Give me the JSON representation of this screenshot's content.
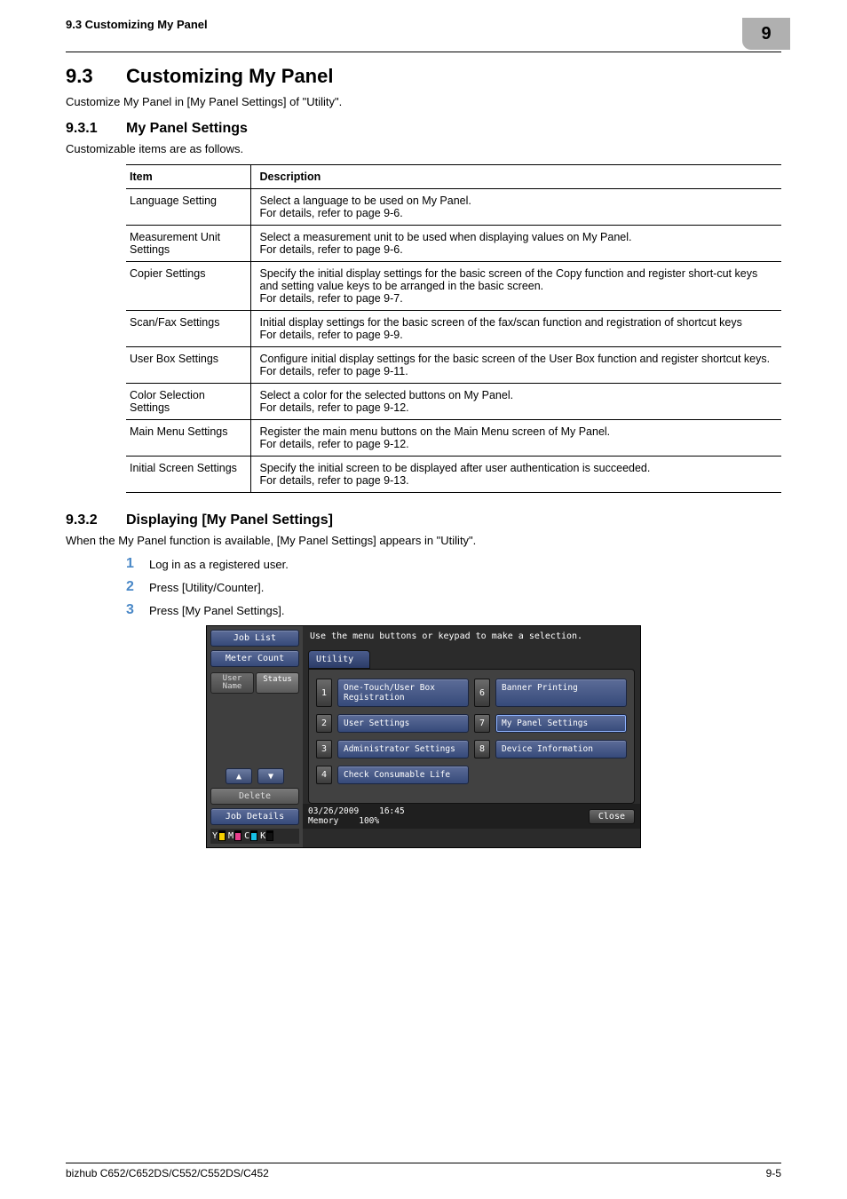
{
  "running_header": {
    "left": "9.3    Customizing My Panel",
    "chapter": "9"
  },
  "h2": {
    "num": "9.3",
    "title": "Customizing My Panel"
  },
  "h2_body": "Customize My Panel in [My Panel Settings] of \"Utility\".",
  "h3a": {
    "num": "9.3.1",
    "title": "My Panel Settings"
  },
  "h3a_body": "Customizable items are as follows.",
  "table": {
    "head": {
      "item": "Item",
      "desc": "Description"
    },
    "rows": [
      {
        "item": "Language Setting",
        "desc": "Select a language to be used on My Panel.\nFor details, refer to page 9-6."
      },
      {
        "item": "Measurement Unit Settings",
        "desc": "Select a measurement unit to be used when displaying values on My Panel.\nFor details, refer to page 9-6."
      },
      {
        "item": "Copier Settings",
        "desc": "Specify the initial display settings for the basic screen of the Copy function and register short-cut keys and setting value keys to be arranged in the basic screen.\nFor details, refer to page 9-7."
      },
      {
        "item": "Scan/Fax Settings",
        "desc": "Initial display settings for the basic screen of the fax/scan function and registration of shortcut keys\nFor details, refer to page 9-9."
      },
      {
        "item": "User Box Settings",
        "desc": "Configure initial display settings for the basic screen of the User Box function and register shortcut keys.\nFor details, refer to page 9-11."
      },
      {
        "item": "Color Selection Settings",
        "desc": "Select a color for the selected buttons on My Panel.\nFor details, refer to page 9-12."
      },
      {
        "item": "Main Menu Settings",
        "desc": "Register the main menu buttons on the Main Menu screen of My Panel.\nFor details, refer to page 9-12."
      },
      {
        "item": "Initial Screen Settings",
        "desc": "Specify the initial screen to be displayed after user authentication is succeeded.\nFor details, refer to page 9-13."
      }
    ]
  },
  "h3b": {
    "num": "9.3.2",
    "title": "Displaying [My Panel Settings]"
  },
  "h3b_body": "When the My Panel function is available, [My Panel Settings] appears in \"Utility\".",
  "steps": [
    {
      "n": "1",
      "t": "Log in as a registered user."
    },
    {
      "n": "2",
      "t": "Press [Utility/Counter]."
    },
    {
      "n": "3",
      "t": "Press [My Panel Settings]."
    }
  ],
  "panel": {
    "left": {
      "job_list": "Job List",
      "meter_count": "Meter Count",
      "tabs": {
        "name": "User\nName",
        "status": "Status"
      },
      "delete": "Delete",
      "job_details": "Job Details",
      "toners": [
        {
          "l": "Y",
          "c": "#f5d000"
        },
        {
          "l": "M",
          "c": "#e83e8c"
        },
        {
          "l": "C",
          "c": "#17c1e8"
        },
        {
          "l": "K",
          "c": "#111"
        }
      ]
    },
    "right": {
      "top_msg": "Use the menu buttons or keypad to make a selection.",
      "utility": "Utility",
      "menu": [
        {
          "n": "1",
          "label": "One-Touch/User Box\nRegistration"
        },
        {
          "n": "2",
          "label": "User Settings"
        },
        {
          "n": "3",
          "label": "Administrator Settings"
        },
        {
          "n": "4",
          "label": "Check Consumable Life"
        },
        {
          "n": "6",
          "label": "Banner Printing"
        },
        {
          "n": "7",
          "label": "My Panel Settings"
        },
        {
          "n": "8",
          "label": "Device Information"
        }
      ],
      "bottom": {
        "date": "03/26/2009",
        "time": "16:45",
        "memory_label": "Memory",
        "memory_val": "100%",
        "close": "Close"
      }
    }
  },
  "footer": {
    "left": "bizhub C652/C652DS/C552/C552DS/C452",
    "right": "9-5"
  }
}
